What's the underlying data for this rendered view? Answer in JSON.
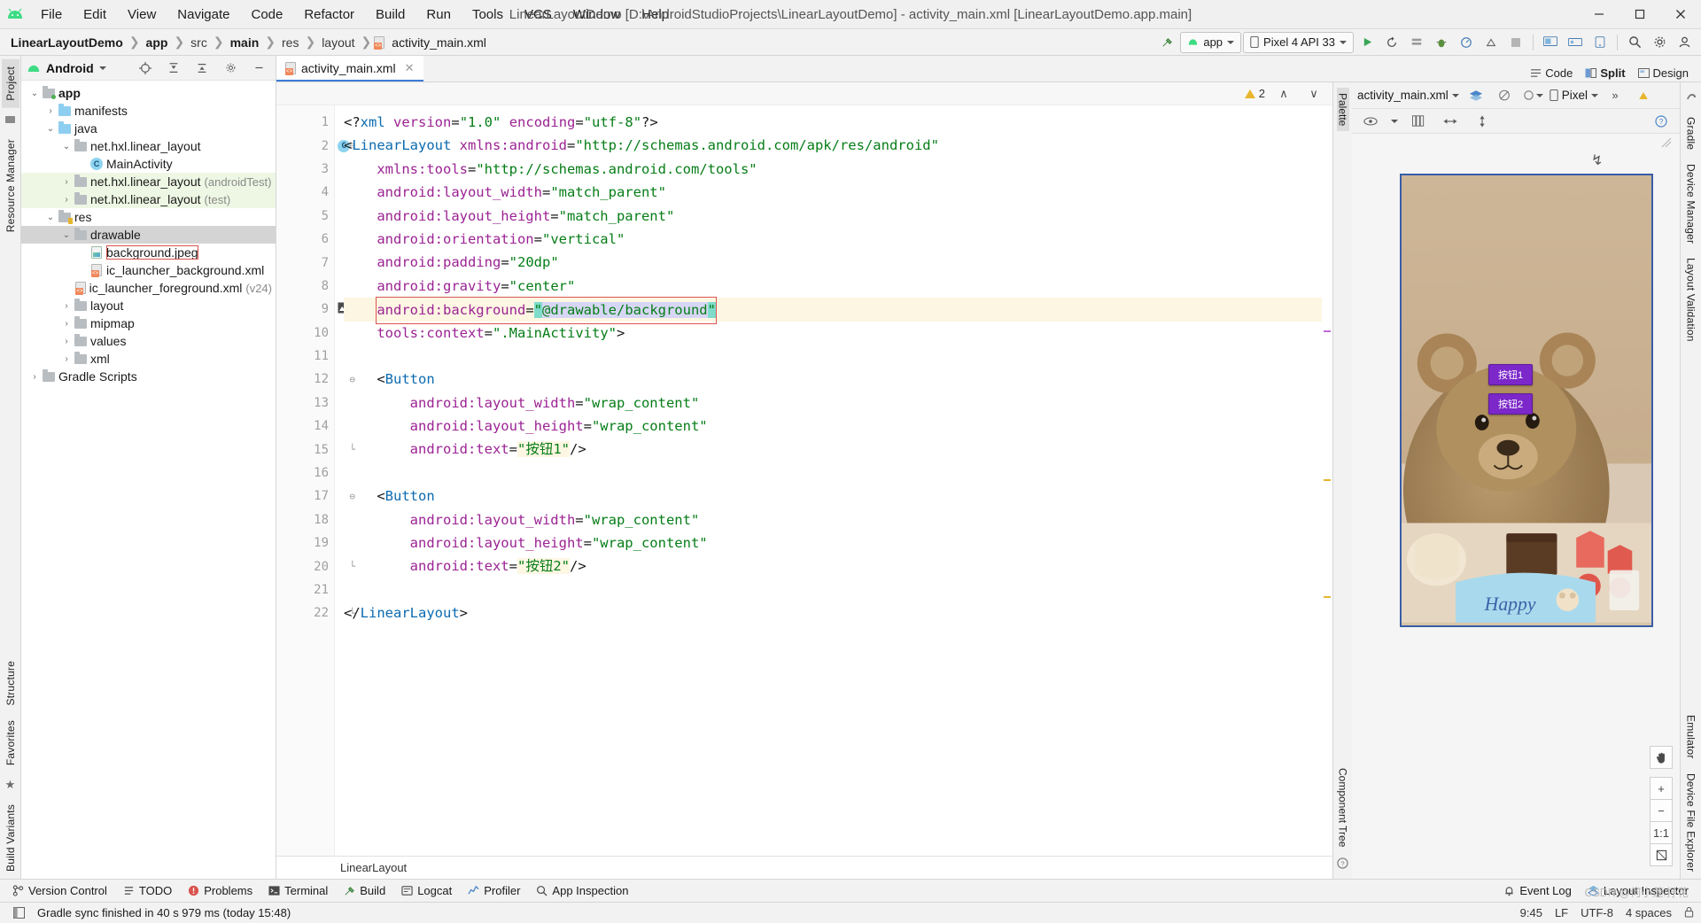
{
  "window": {
    "title": "LinearLayoutDemo [D:\\AndroidStudioProjects\\LinearLayoutDemo] - activity_main.xml [LinearLayoutDemo.app.main]",
    "minimize": "–",
    "maximize": "❐",
    "close": "✕"
  },
  "menubar": {
    "items": [
      "File",
      "Edit",
      "View",
      "Navigate",
      "Code",
      "Refactor",
      "Build",
      "Run",
      "Tools",
      "VCS",
      "Window",
      "Help"
    ]
  },
  "breadcrumb": {
    "items": [
      "LinearLayoutDemo",
      "app",
      "src",
      "main",
      "res",
      "layout",
      "activity_main.xml"
    ]
  },
  "nav_toolbar": {
    "build_icon": "hammer-icon",
    "app_config": "app",
    "device": "Pixel 4 API 33",
    "run_icon": "▶",
    "search_icon": "search-icon",
    "settings_icon": "gear-icon"
  },
  "project_panel": {
    "title": "Android",
    "tree": [
      {
        "depth": 0,
        "arrow": "v",
        "icon": "module-folder",
        "label": "app",
        "bold": true,
        "dim": ""
      },
      {
        "depth": 1,
        "arrow": ">",
        "icon": "folder-blue",
        "label": "manifests",
        "bold": false,
        "dim": ""
      },
      {
        "depth": 1,
        "arrow": "v",
        "icon": "folder-blue",
        "label": "java",
        "bold": false,
        "dim": ""
      },
      {
        "depth": 2,
        "arrow": "v",
        "icon": "package",
        "label": "net.hxl.linear_layout",
        "bold": false,
        "dim": ""
      },
      {
        "depth": 3,
        "arrow": "none",
        "icon": "class",
        "label": "MainActivity",
        "bold": false,
        "dim": ""
      },
      {
        "depth": 2,
        "arrow": ">",
        "icon": "package",
        "label": "net.hxl.linear_layout",
        "bold": false,
        "dim": "(androidTest)",
        "bg": "test"
      },
      {
        "depth": 2,
        "arrow": ">",
        "icon": "package",
        "label": "net.hxl.linear_layout",
        "bold": false,
        "dim": "(test)",
        "bg": "test"
      },
      {
        "depth": 1,
        "arrow": "v",
        "icon": "res-folder",
        "label": "res",
        "bold": false,
        "dim": ""
      },
      {
        "depth": 2,
        "arrow": "v",
        "icon": "package",
        "label": "drawable",
        "bold": false,
        "dim": "",
        "bg": "selected"
      },
      {
        "depth": 3,
        "arrow": "none",
        "icon": "image-file",
        "label": "background.jpeg",
        "bold": false,
        "dim": "",
        "highlight": true
      },
      {
        "depth": 3,
        "arrow": "none",
        "icon": "xml-file",
        "label": "ic_launcher_background.xml",
        "bold": false,
        "dim": ""
      },
      {
        "depth": 3,
        "arrow": "none",
        "icon": "xml-file",
        "label": "ic_launcher_foreground.xml",
        "bold": false,
        "dim": "(v24)"
      },
      {
        "depth": 2,
        "arrow": ">",
        "icon": "package",
        "label": "layout",
        "bold": false,
        "dim": ""
      },
      {
        "depth": 2,
        "arrow": ">",
        "icon": "package",
        "label": "mipmap",
        "bold": false,
        "dim": ""
      },
      {
        "depth": 2,
        "arrow": ">",
        "icon": "package",
        "label": "values",
        "bold": false,
        "dim": ""
      },
      {
        "depth": 2,
        "arrow": ">",
        "icon": "package",
        "label": "xml",
        "bold": false,
        "dim": ""
      },
      {
        "depth": 0,
        "arrow": ">",
        "icon": "gradle-folder",
        "label": "Gradle Scripts",
        "bold": false,
        "dim": ""
      }
    ]
  },
  "left_strip": {
    "tabs": [
      "Project",
      "Resource Manager",
      "Structure",
      "Favorites",
      "Build Variants"
    ]
  },
  "right_strip": {
    "tabs": [
      "Gradle",
      "Device Manager",
      "Layout Validation",
      "Emulator",
      "Device File Explorer"
    ]
  },
  "editor": {
    "tab": {
      "label": "activity_main.xml",
      "close": "✕"
    },
    "view_modes": [
      {
        "label": "Code",
        "selected": false
      },
      {
        "label": "Split",
        "selected": true
      },
      {
        "label": "Design",
        "selected": false
      }
    ],
    "warnings": {
      "count": "2",
      "up": "∧",
      "down": "∨"
    },
    "status_label": "LinearLayout",
    "lines": [
      {
        "n": "1",
        "indent": 0,
        "html": "<span class='punc'>&lt;?</span><span class='tag'>xml</span> <span class='attr'>version</span><span class='eq'>=</span><span class='str'>\"1.0\"</span> <span class='attr'>encoding</span><span class='eq'>=</span><span class='str'>\"utf-8\"</span><span class='punc'>?&gt;</span>"
      },
      {
        "n": "2",
        "indent": 0,
        "gmark": "class-badge",
        "fold": true,
        "html": "<span class='punc'>&lt;</span><span class='tag'>LinearLayout</span> <span class='ns'>xmlns:android</span><span class='eq'>=</span><span class='str'>\"http://schemas.android.com/apk/res/android\"</span>"
      },
      {
        "n": "3",
        "indent": 1,
        "html": "<span class='ns'>xmlns:tools</span><span class='eq'>=</span><span class='str'>\"http://schemas.android.com/tools\"</span>"
      },
      {
        "n": "4",
        "indent": 1,
        "html": "<span class='attr'>android:layout_width</span><span class='eq'>=</span><span class='str'>\"match_parent\"</span>"
      },
      {
        "n": "5",
        "indent": 1,
        "html": "<span class='attr'>android:layout_height</span><span class='eq'>=</span><span class='str'>\"match_parent\"</span>"
      },
      {
        "n": "6",
        "indent": 1,
        "html": "<span class='attr'>android:orientation</span><span class='eq'>=</span><span class='str'>\"vertical\"</span>"
      },
      {
        "n": "7",
        "indent": 1,
        "html": "<span class='attr'>android:padding</span><span class='eq'>=</span><span class='str'>\"20dp\"</span>"
      },
      {
        "n": "8",
        "indent": 1,
        "html": "<span class='attr'>android:gravity</span><span class='eq'>=</span><span class='str'>\"center\"</span>"
      },
      {
        "n": "9",
        "indent": 1,
        "gmark": "image-badge",
        "hl": true,
        "html": "<span class='line9box'><span class='attr'>android:background</span><span class='eq'>=</span><span class='cursor-blk str'>\"</span><span class='sel-text str'>@drawable/background</span><span class='cursor-blk str'>\"</span></span>"
      },
      {
        "n": "10",
        "indent": 1,
        "html": "<span class='ns'>tools:context</span><span class='eq'>=</span><span class='str'>\".MainActivity\"</span><span class='punc'>&gt;</span>"
      },
      {
        "n": "11",
        "indent": 0,
        "html": ""
      },
      {
        "n": "12",
        "indent": 1,
        "fold": true,
        "html": "<span class='punc'>&lt;</span><span class='tag'>Button</span>"
      },
      {
        "n": "13",
        "indent": 2,
        "html": "<span class='attr'>android:layout_width</span><span class='eq'>=</span><span class='str'>\"wrap_content\"</span>"
      },
      {
        "n": "14",
        "indent": 2,
        "html": "<span class='attr'>android:layout_height</span><span class='eq'>=</span><span class='str'>\"wrap_content\"</span>"
      },
      {
        "n": "15",
        "indent": 2,
        "foldend": true,
        "html": "<span class='attr'>android:text</span><span class='eq'>=</span><span class='hl-str str' style='background:#fdf6e3'>\"按钮1\"</span><span class='punc'>/&gt;</span>"
      },
      {
        "n": "16",
        "indent": 0,
        "html": ""
      },
      {
        "n": "17",
        "indent": 1,
        "fold": true,
        "html": "<span class='punc'>&lt;</span><span class='tag'>Button</span>"
      },
      {
        "n": "18",
        "indent": 2,
        "html": "<span class='attr'>android:layout_width</span><span class='eq'>=</span><span class='str'>\"wrap_content\"</span>"
      },
      {
        "n": "19",
        "indent": 2,
        "html": "<span class='attr'>android:layout_height</span><span class='eq'>=</span><span class='str'>\"wrap_content\"</span>"
      },
      {
        "n": "20",
        "indent": 2,
        "foldend": true,
        "html": "<span class='attr'>android:text</span><span class='eq'>=</span><span class='hl-str str' style='background:#fdf6e3'>\"按钮2\"</span><span class='punc'>/&gt;</span>"
      },
      {
        "n": "21",
        "indent": 0,
        "html": ""
      },
      {
        "n": "22",
        "indent": 0,
        "foldend": true,
        "html": "<span class='punc'>&lt;/</span><span class='tag'>LinearLayout</span><span class='punc'>&gt;</span>"
      }
    ]
  },
  "editor_edges": {
    "palette": "Palette",
    "component_tree": "Component Tree"
  },
  "preview": {
    "file": "activity_main.xml",
    "device": "Pixel",
    "buttons": [
      "按钮1",
      "按钮2"
    ],
    "tools": [
      "✋",
      "+",
      "−",
      "1:1",
      "❐"
    ],
    "zoom_label": "1:1"
  },
  "bottom_bar": {
    "items": [
      {
        "label": "Version Control",
        "icon": "branch-icon"
      },
      {
        "label": "TODO",
        "icon": "list-icon"
      },
      {
        "label": "Problems",
        "icon": "error-icon"
      },
      {
        "label": "Terminal",
        "icon": "terminal-icon"
      },
      {
        "label": "Build",
        "icon": "hammer-icon"
      },
      {
        "label": "Logcat",
        "icon": "logcat-icon"
      },
      {
        "label": "Profiler",
        "icon": "profiler-icon"
      },
      {
        "label": "App Inspection",
        "icon": "inspect-icon"
      }
    ],
    "right_items": [
      {
        "label": "Event Log",
        "icon": "bell-icon"
      },
      {
        "label": "Layout Inspector",
        "icon": "layers-icon"
      }
    ]
  },
  "statusbar": {
    "message": "Gradle sync finished in 40 s 979 ms (today 15:48)",
    "caret": "9:45",
    "line_sep": "LF",
    "encoding": "UTF-8",
    "indent": "4 spaces",
    "watermark": "CSDN @何小莲.抒花"
  },
  "colors": {
    "accent": "#3c7cd6",
    "string": "#067d17",
    "attribute": "#9b2393",
    "tag": "#0b6ab0",
    "highlight_box": "#d9534f",
    "selection": "#d7d7f5",
    "button_purple": "#7b27c9"
  }
}
